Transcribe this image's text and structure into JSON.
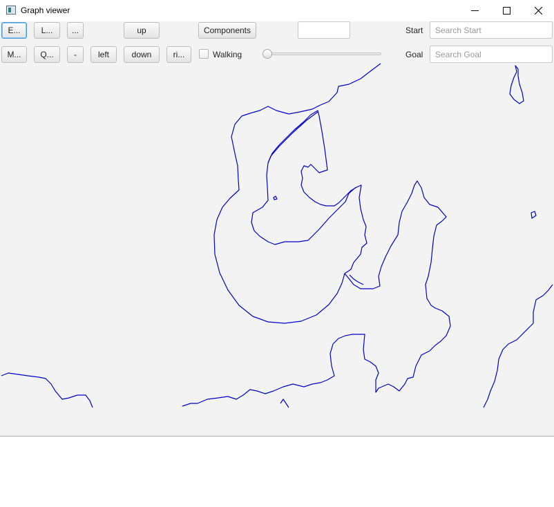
{
  "window": {
    "title": "Graph viewer",
    "minimize_icon": "minimize-icon",
    "maximize_icon": "maximize-icon",
    "close_icon": "close-icon"
  },
  "toolbar": {
    "row1": {
      "b1": "E...",
      "b2": "L...",
      "b3": "...",
      "up": "up",
      "components": "Components",
      "text_value": ""
    },
    "row2": {
      "b1": "M...",
      "b2": "Q...",
      "minus": "-",
      "left": "left",
      "down": "down",
      "right": "ri...",
      "walking": "Walking"
    },
    "start_label": "Start",
    "start_placeholder": "Search Start",
    "goal_label": "Goal",
    "goal_placeholder": "Search Goal",
    "walking_checked": false,
    "slider_value": 0
  },
  "map": {
    "line_color": "#0000cc"
  }
}
